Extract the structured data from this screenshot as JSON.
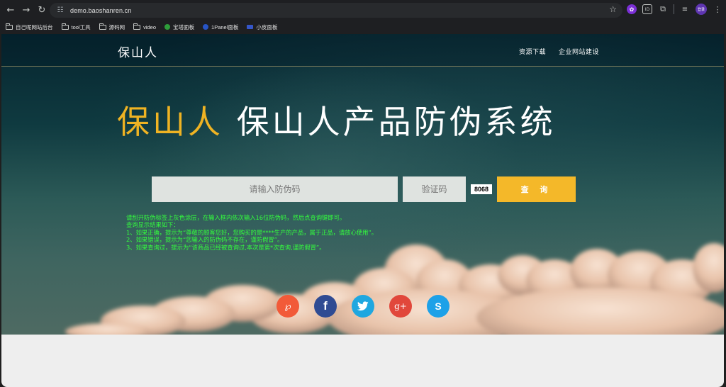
{
  "browser": {
    "url": "demo.baoshanren.cn",
    "bookmarks": [
      {
        "label": "自己呢网站后台",
        "icon": "folder-icon"
      },
      {
        "label": "tool工具",
        "icon": "folder-icon"
      },
      {
        "label": "源码网",
        "icon": "folder-icon"
      },
      {
        "label": "video",
        "icon": "folder-icon"
      },
      {
        "label": "宝塔面板",
        "icon": "bt-panel-icon"
      },
      {
        "label": "1Panel面板",
        "icon": "1panel-icon"
      },
      {
        "label": "小皮面板",
        "icon": "xp-panel-icon"
      }
    ],
    "profile_badge": "登录",
    "extension_badge": "ID"
  },
  "site": {
    "logo": "保山人",
    "nav": [
      "资源下载",
      "企业网站建设"
    ],
    "headline_brand": "保山人",
    "headline_rest": "保山人产品防伪系统",
    "code_placeholder": "请输入防伪码",
    "captcha_placeholder": "验证码",
    "captcha_value": "8068",
    "query_label": "查 询",
    "instructions": [
      "请刮开防伪标签上灰色涂层，在输入框内依次输入16位防伪码，然后点查询键即可。",
      "查询显示结果如下：",
      "1、如果正确，提示为“尊敬的顾客您好，您购买的是****生产的产品，属于正品，请放心使用”。",
      "2、如果错误，提示为“您输入的防伪码不存在，谨防假冒”。",
      "3、如果查询过，提示为“该商品已经被查询过,本次是第*次查询,谨防假冒”。"
    ],
    "social": [
      {
        "name": "pinterest-icon",
        "glyph": "℘"
      },
      {
        "name": "facebook-icon",
        "glyph": "f"
      },
      {
        "name": "twitter-icon",
        "glyph": ""
      },
      {
        "name": "google-plus-icon",
        "glyph": "g+"
      },
      {
        "name": "skype-icon",
        "glyph": "S"
      }
    ]
  },
  "colors": {
    "accent": "#f4b829",
    "instruction_text": "#33ff3d",
    "headline_brand": "#efb323"
  }
}
